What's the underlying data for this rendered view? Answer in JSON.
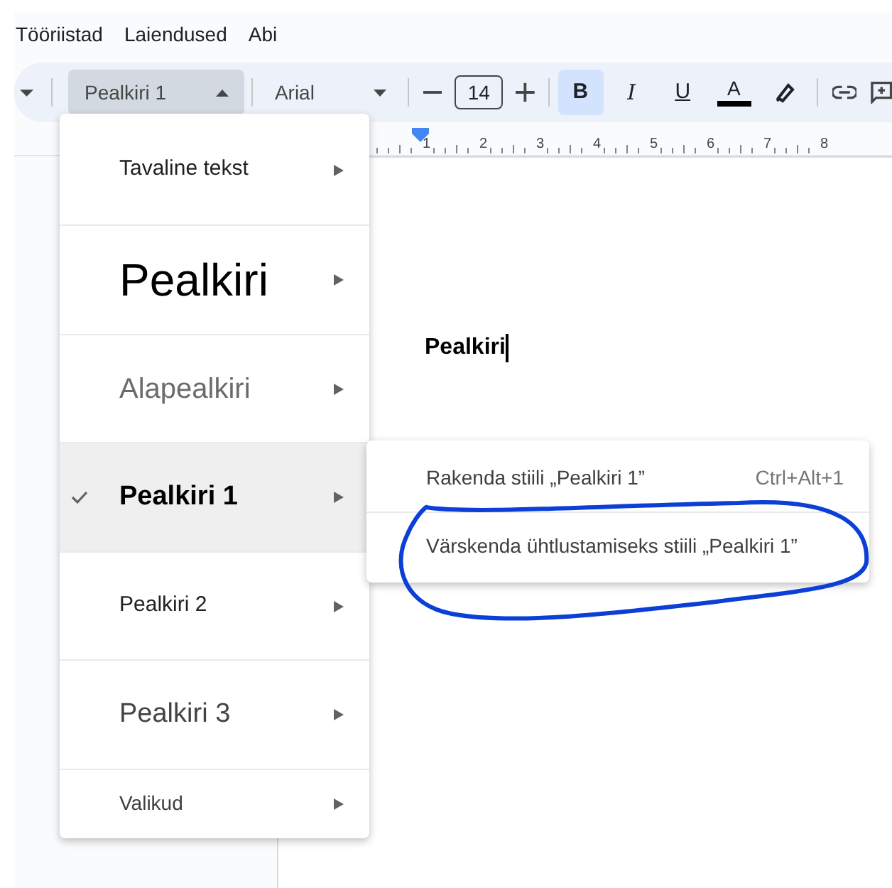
{
  "menu_bar": [
    "Tööriistad",
    "Laiendused",
    "Abi"
  ],
  "toolbar": {
    "style_select": {
      "value": "Pealkiri 1",
      "expanded": true
    },
    "font_select": {
      "value": "Arial"
    },
    "font_size": "14",
    "format_buttons": [
      {
        "kind": "bold",
        "label": "B",
        "on": true
      },
      {
        "kind": "italic",
        "label": "I",
        "on": false
      },
      {
        "kind": "underline",
        "label": "U",
        "on": false
      }
    ],
    "text_color": {
      "label": "A"
    }
  },
  "ruler": {
    "numbers": [
      "1",
      "2",
      "3",
      "4",
      "5",
      "6",
      "7",
      "8"
    ]
  },
  "document": {
    "heading": "Pealkiri"
  },
  "style_menu": {
    "items": [
      {
        "label": "Tavaline tekst",
        "kind": "normal",
        "selected": false
      },
      {
        "label": "Pealkiri",
        "kind": "title",
        "selected": false
      },
      {
        "label": "Alapealkiri",
        "kind": "subtitle",
        "selected": false
      },
      {
        "label": "Pealkiri 1",
        "kind": "h1",
        "selected": true
      },
      {
        "label": "Pealkiri 2",
        "kind": "h2",
        "selected": false
      },
      {
        "label": "Pealkiri 3",
        "kind": "h3",
        "selected": false
      },
      {
        "label": "Valikud",
        "kind": "options",
        "selected": false
      }
    ]
  },
  "submenu": {
    "items": [
      {
        "label": "Rakenda stiili „Pealkiri 1”",
        "shortcut": "Ctrl+Alt+1"
      },
      {
        "label": "Värskenda ühtlustamiseks stiili „Pealkiri 1”"
      }
    ]
  }
}
